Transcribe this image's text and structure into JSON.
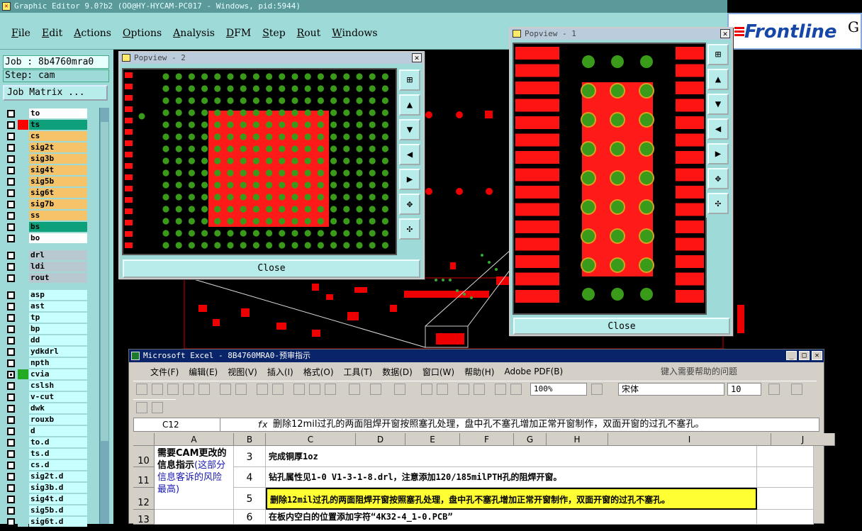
{
  "app": {
    "title": "Graphic Editor 9.0?b2 (OO@HY-HYCAM-PC017 - Windows, pid:5944)"
  },
  "menu": [
    "File",
    "Edit",
    "Actions",
    "Options",
    "Analysis",
    "DFM",
    "Step",
    "Rout",
    "Windows"
  ],
  "brand": {
    "name": "Frontline",
    "suffix": "G"
  },
  "job": {
    "label": "Job : 8b4760mra0",
    "step": "Step: cam",
    "matrix_button": "Job Matrix ..."
  },
  "layers": [
    {
      "name": "to",
      "color": "#ffffff",
      "swatch": "#9ddad8"
    },
    {
      "name": "ts",
      "color": "#0ea07a",
      "swatch": "#ff0000"
    },
    {
      "name": "cs",
      "color": "#f5c46a",
      "swatch": "#9ddad8"
    },
    {
      "name": "sig2t",
      "color": "#f5c46a",
      "swatch": "#9ddad8"
    },
    {
      "name": "sig3b",
      "color": "#f5c46a",
      "swatch": "#9ddad8"
    },
    {
      "name": "sig4t",
      "color": "#f5c46a",
      "swatch": "#9ddad8"
    },
    {
      "name": "sig5b",
      "color": "#f5c46a",
      "swatch": "#9ddad8"
    },
    {
      "name": "sig6t",
      "color": "#f5c46a",
      "swatch": "#9ddad8"
    },
    {
      "name": "sig7b",
      "color": "#f5c46a",
      "swatch": "#9ddad8"
    },
    {
      "name": "ss",
      "color": "#f5c46a",
      "swatch": "#9ddad8"
    },
    {
      "name": "bs",
      "color": "#0ea07a",
      "swatch": "#9ddad8"
    },
    {
      "name": "bo",
      "color": "#ffffff",
      "swatch": "#9ddad8"
    },
    {
      "name": "drl",
      "color": "#b8c8d0",
      "swatch": "#9ddad8"
    },
    {
      "name": "ldi",
      "color": "#b8c8d0",
      "swatch": "#9ddad8"
    },
    {
      "name": "rout",
      "color": "#b8c8d0",
      "swatch": "#9ddad8"
    },
    {
      "name": "asp",
      "color": "#c8ffff",
      "swatch": "#9ddad8"
    },
    {
      "name": "ast",
      "color": "#c8ffff",
      "swatch": "#9ddad8"
    },
    {
      "name": "tp",
      "color": "#c8ffff",
      "swatch": "#9ddad8"
    },
    {
      "name": "bp",
      "color": "#c8ffff",
      "swatch": "#9ddad8"
    },
    {
      "name": "dd",
      "color": "#c8ffff",
      "swatch": "#9ddad8"
    },
    {
      "name": "ydkdrl",
      "color": "#c8ffff",
      "swatch": "#9ddad8"
    },
    {
      "name": "npth",
      "color": "#c8ffff",
      "swatch": "#9ddad8"
    },
    {
      "name": "cvia",
      "color": "#c8ffff",
      "swatch": "#22aa22"
    },
    {
      "name": "cslsh",
      "color": "#c8ffff",
      "swatch": "#9ddad8"
    },
    {
      "name": "v-cut",
      "color": "#c8ffff",
      "swatch": "#9ddad8"
    },
    {
      "name": "dwk",
      "color": "#c8ffff",
      "swatch": "#9ddad8"
    },
    {
      "name": "rouxb",
      "color": "#c8ffff",
      "swatch": "#9ddad8"
    },
    {
      "name": "d",
      "color": "#c8ffff",
      "swatch": "#9ddad8"
    },
    {
      "name": "to.d",
      "color": "#c8ffff",
      "swatch": "#9ddad8"
    },
    {
      "name": "ts.d",
      "color": "#c8ffff",
      "swatch": "#9ddad8"
    },
    {
      "name": "cs.d",
      "color": "#c8ffff",
      "swatch": "#9ddad8"
    },
    {
      "name": "sig2t.d",
      "color": "#c8ffff",
      "swatch": "#9ddad8"
    },
    {
      "name": "sig3b.d",
      "color": "#c8ffff",
      "swatch": "#9ddad8"
    },
    {
      "name": "sig4t.d",
      "color": "#c8ffff",
      "swatch": "#9ddad8"
    },
    {
      "name": "sig5b.d",
      "color": "#c8ffff",
      "swatch": "#9ddad8"
    },
    {
      "name": "sig6t.d",
      "color": "#c8ffff",
      "swatch": "#9ddad8"
    }
  ],
  "popview2": {
    "title": "Popview - 2",
    "close": "Close"
  },
  "popview1": {
    "title": "Popview - 1",
    "close": "Close"
  },
  "excel": {
    "title": "Microsoft Excel - 8B4760MRA0-预审指示",
    "menu": [
      "文件(F)",
      "编辑(E)",
      "视图(V)",
      "插入(I)",
      "格式(O)",
      "工具(T)",
      "数据(D)",
      "窗口(W)",
      "帮助(H)",
      "Adobe PDF(B)"
    ],
    "help_placeholder": "键入需要帮助的问题",
    "zoom": "100%",
    "font": "宋体",
    "font_size": "10",
    "name_box": "C12",
    "formula": "删除12mil过孔的两面阻焊开窗按照塞孔处理，盘中孔不塞孔增加正常开窗制作，双面开窗的过孔不塞孔。",
    "columns": [
      "A",
      "B",
      "C",
      "D",
      "E",
      "F",
      "G",
      "H",
      "I",
      "J"
    ],
    "rows": [
      "10",
      "11",
      "12",
      "13"
    ],
    "a_note": "需要CAM更改的信息指示",
    "a_note2": "(这部分信息客诉的风险最高)",
    "items": [
      {
        "num": "3",
        "text": "完成铜厚1oz"
      },
      {
        "num": "4",
        "text": "钻孔属性见1-0 V1-3-1-8.drl，注意添加120/185milPTH孔的阻焊开窗。"
      },
      {
        "num": "5",
        "text": "删除12mil过孔的两面阻焊开窗按照塞孔处理，盘中孔不塞孔增加正常开窗制作，双面开窗的过孔不塞孔。"
      },
      {
        "num": "6",
        "text": "在板内空白的位置添加字符“4K32-4_1-0.PCB”"
      }
    ]
  }
}
